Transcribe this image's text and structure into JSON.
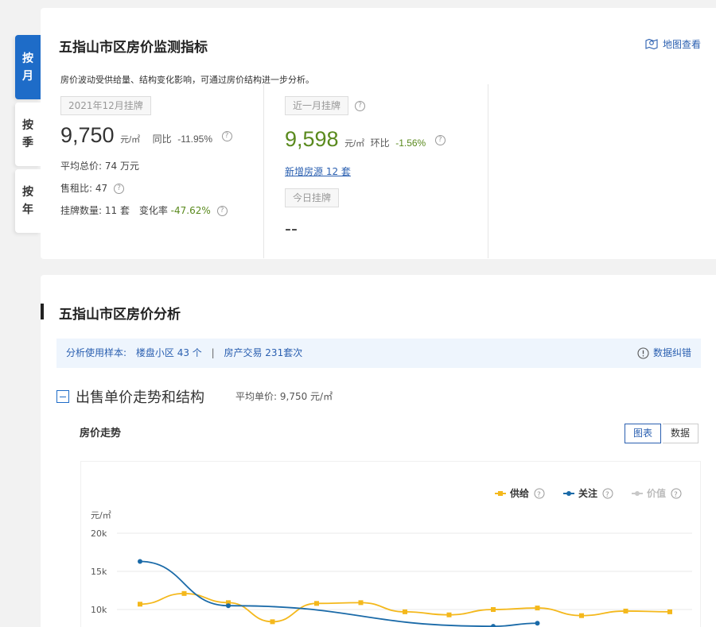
{
  "tabs": [
    {
      "chars": [
        "按",
        "月"
      ],
      "active": true
    },
    {
      "chars": [
        "按",
        "季"
      ],
      "active": false
    },
    {
      "chars": [
        "按",
        "年"
      ],
      "active": false
    }
  ],
  "monitor": {
    "title": "五指山市区房价监测指标",
    "map_link": "地图查看",
    "desc": "房价波动受供给量、结构变化影响，可通过房价结构进一步分析。",
    "listing": {
      "tag": "2021年12月挂牌",
      "price": "9,750",
      "unit": "元/㎡",
      "yoy_label": "同比",
      "yoy_value": "-11.95%",
      "avg_total_label": "平均总价:",
      "avg_total_value": "74",
      "avg_total_unit": "万元",
      "rent_ratio_label": "售租比:",
      "rent_ratio_value": "47",
      "count_label": "挂牌数量:",
      "count_value": "11",
      "count_unit": "套",
      "change_label": "变化率",
      "change_value": "-47.62%"
    },
    "recent": {
      "tag": "近一月挂牌",
      "price": "9,598",
      "unit": "元/㎡",
      "mom_label": "环比",
      "mom_value": "-1.56%",
      "new_listing": "新增房源 12 套",
      "today_tag": "今日挂牌",
      "today_value": "--"
    }
  },
  "analysis": {
    "title": "五指山市区房价分析",
    "sample_label": "分析使用样本:",
    "sample_community": "楼盘小区 43 个",
    "sample_sep": "|",
    "sample_trade": "房产交易 231套次",
    "correct_label": "数据纠错",
    "section_title": "出售单价走势和结构",
    "avg_label": "平均单价:",
    "avg_value": "9,750 元/㎡",
    "trend_title": "房价走势",
    "toggle_chart": "图表",
    "toggle_data": "数据"
  },
  "colors": {
    "supply": "#f4b81c",
    "attention": "#1a6aa8",
    "value": "#c8c8c8",
    "accent": "#1e6cc8"
  },
  "chart_data": {
    "type": "line",
    "ylabel": "元/㎡",
    "yticks": [
      "20k",
      "15k",
      "10k"
    ],
    "ylim": [
      0,
      20000
    ],
    "legend": "top-right",
    "series": [
      {
        "name": "供给",
        "values": [
          10700,
          12100,
          10900,
          8400,
          10800,
          10900,
          9700,
          9300,
          10000,
          10200,
          9200,
          9800,
          9700
        ]
      },
      {
        "name": "关注",
        "values": [
          16300,
          null,
          10500,
          null,
          null,
          null,
          null,
          null,
          7800,
          8200,
          null,
          null,
          null
        ]
      },
      {
        "name": "价值",
        "values": []
      }
    ]
  }
}
